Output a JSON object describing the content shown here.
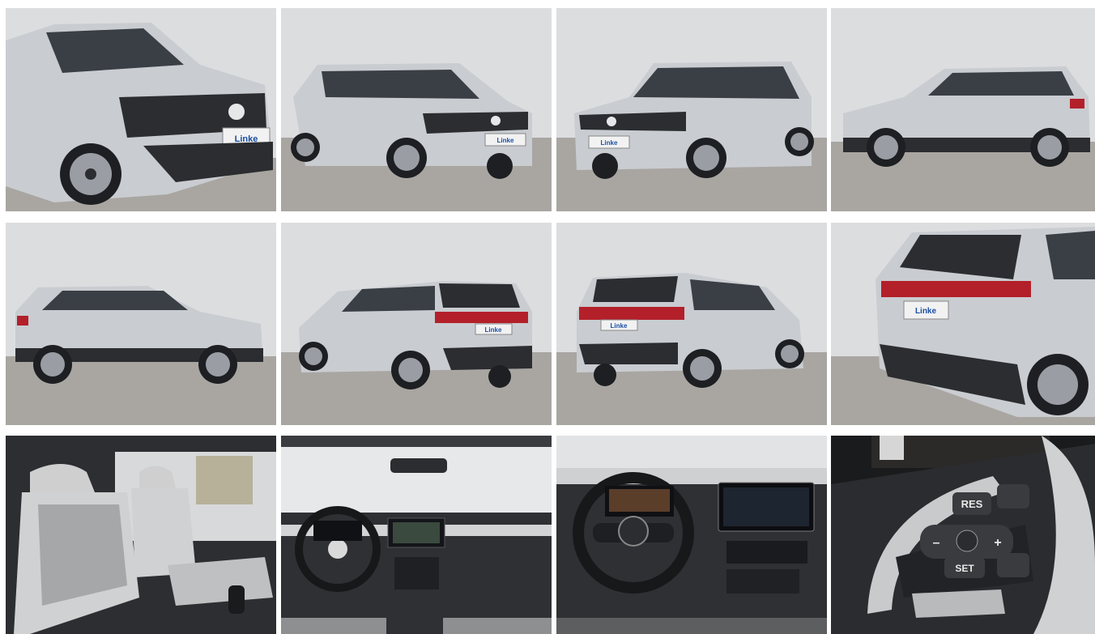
{
  "gallery": {
    "photos": [
      {
        "id": "photo-1",
        "plate": "Linke"
      },
      {
        "id": "photo-2",
        "plate": "Linke"
      },
      {
        "id": "photo-3",
        "plate": "Linke"
      },
      {
        "id": "photo-4"
      },
      {
        "id": "photo-5"
      },
      {
        "id": "photo-6",
        "plate": "Linke"
      },
      {
        "id": "photo-7",
        "plate": "Linke"
      },
      {
        "id": "photo-8",
        "plate": "Linke"
      },
      {
        "id": "photo-9"
      },
      {
        "id": "photo-10"
      },
      {
        "id": "photo-11"
      },
      {
        "id": "photo-12",
        "buttons": {
          "res": "RES",
          "set": "SET",
          "minus": "–",
          "plus": "+"
        }
      }
    ]
  },
  "colors": {
    "car_body": "#c9ccd0",
    "wall": "#dcdddf",
    "pavement": "#a9a6a2",
    "trim": "#2b2d30",
    "taillight": "#b3202a",
    "plate_text": "#1a4fa3"
  }
}
